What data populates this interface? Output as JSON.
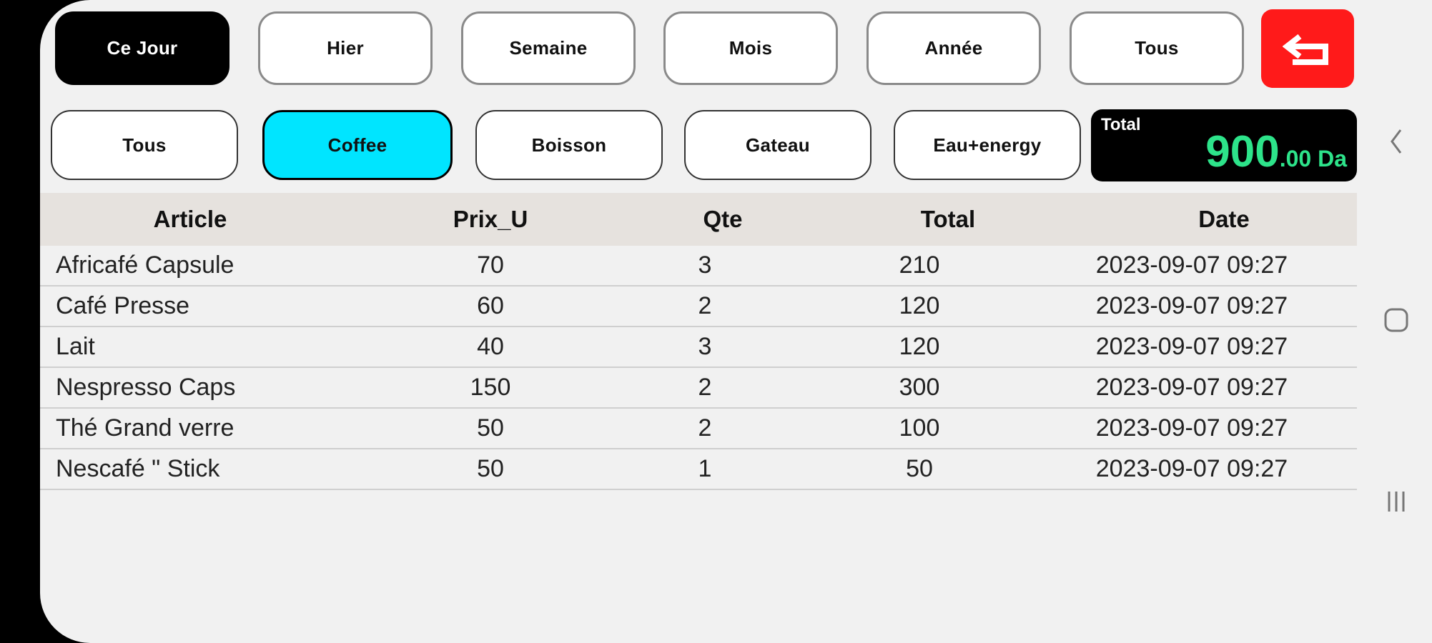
{
  "period_filters": [
    "Ce Jour",
    "Hier",
    "Semaine",
    "Mois",
    "Année",
    "Tous"
  ],
  "category_filters": [
    "Tous",
    "Coffee",
    "Boisson",
    "Gateau",
    "Eau+energy"
  ],
  "total": {
    "label": "Total",
    "integer": "900",
    "decimal": ".00 Da"
  },
  "table": {
    "headers": [
      "Article",
      "Prix_U",
      "Qte",
      "Total",
      "Date"
    ],
    "rows": [
      [
        "Africafé Capsule",
        "70",
        "3",
        "210",
        "2023-09-07 09:27"
      ],
      [
        "Café Presse",
        "60",
        "2",
        "120",
        "2023-09-07 09:27"
      ],
      [
        "Lait",
        "40",
        "3",
        "120",
        "2023-09-07 09:27"
      ],
      [
        "Nespresso Caps",
        "150",
        "2",
        "300",
        "2023-09-07 09:27"
      ],
      [
        "Thé Grand verre",
        "50",
        "2",
        "100",
        "2023-09-07 09:27"
      ],
      [
        "Nescafé  \" Stick",
        "50",
        "1",
        "50",
        "2023-09-07 09:27"
      ]
    ]
  },
  "colors": {
    "active_period_bg": "#000000",
    "selected_category_bg": "#00e5ff",
    "back_button_bg": "#ff1a1a",
    "total_amount_color": "#2de38a"
  },
  "icons": {
    "back": "return-arrow-icon",
    "nav_back": "chevron-left-icon",
    "nav_home": "rounded-square-icon",
    "nav_recents": "three-bars-icon"
  }
}
